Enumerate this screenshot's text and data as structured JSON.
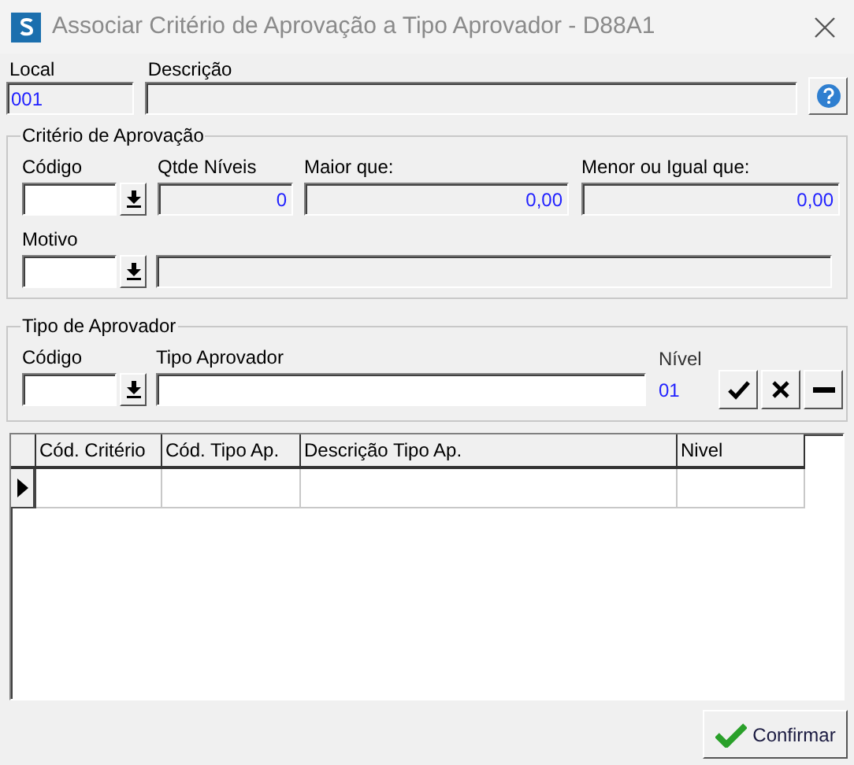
{
  "window": {
    "title": "Associar Critério de Aprovação a Tipo Aprovador - D88A1"
  },
  "header": {
    "local_label": "Local",
    "local_value": "001",
    "descricao_label": "Descrição"
  },
  "criterio": {
    "title": "Critério de Aprovação",
    "codigo_label": "Código",
    "qtde_label": "Qtde Níveis",
    "qtde_value": "0",
    "maior_label": "Maior que:",
    "maior_value": "0,00",
    "menor_label": "Menor ou Igual que:",
    "menor_value": "0,00",
    "motivo_label": "Motivo"
  },
  "tipo_aprovador": {
    "title": "Tipo de Aprovador",
    "codigo_label": "Código",
    "tipo_label": "Tipo Aprovador",
    "nivel_label": "Nível",
    "nivel_value": "01"
  },
  "table": {
    "columns": [
      "Cód. Critério",
      "Cód. Tipo Ap.",
      "Descrição Tipo Ap.",
      "Nivel"
    ],
    "rows": [
      {
        "current": true
      }
    ]
  },
  "buttons": [
    {
      "label": "Confirmar"
    }
  ]
}
